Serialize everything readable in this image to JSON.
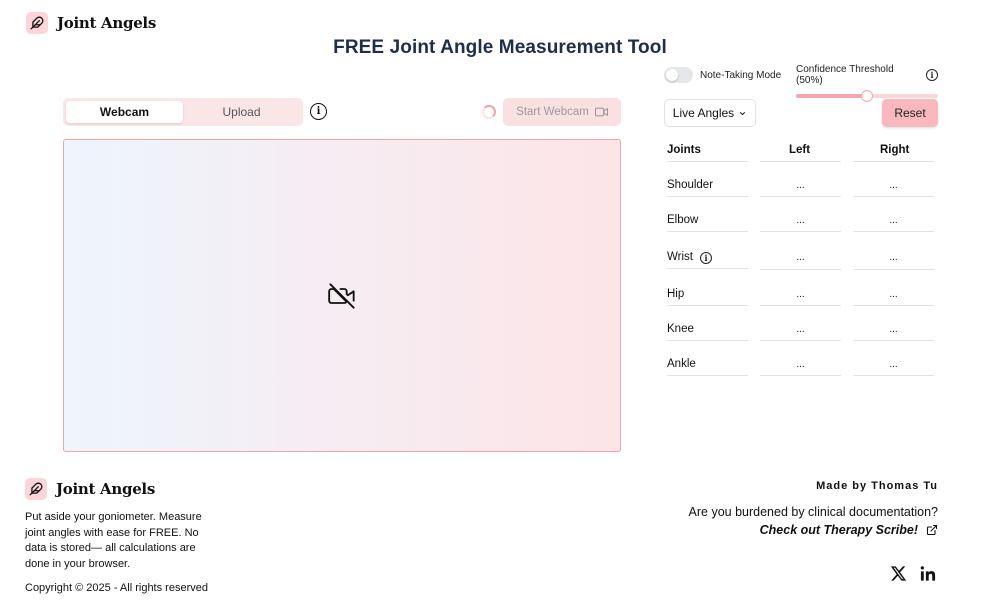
{
  "header": {
    "brand": "Joint Angels"
  },
  "page_title": "FREE Joint Angle Measurement Tool",
  "controls": {
    "note_taking_label": "Note-Taking Mode",
    "note_taking_on": false,
    "confidence_label": "Confidence Threshold (50%)",
    "confidence_value": 0.5
  },
  "tabs": [
    {
      "label": "Webcam",
      "active": true
    },
    {
      "label": "Upload",
      "active": false
    }
  ],
  "start_webcam_label": "Start Webcam",
  "view_select_value": "Live Angles",
  "reset_label": "Reset",
  "angles_table": {
    "headers": [
      "Joints",
      "Left",
      "Right"
    ],
    "rows": [
      {
        "joint": "Shoulder",
        "left": "...",
        "right": "..."
      },
      {
        "joint": "Elbow",
        "left": "...",
        "right": "..."
      },
      {
        "joint": "Wrist",
        "left": "...",
        "right": "..."
      },
      {
        "joint": "Hip",
        "left": "...",
        "right": "..."
      },
      {
        "joint": "Knee",
        "left": "...",
        "right": "..."
      },
      {
        "joint": "Ankle",
        "left": "...",
        "right": "..."
      }
    ]
  },
  "footer": {
    "brand": "Joint Angels",
    "description": "Put aside your goniometer. Measure joint angles with ease for FREE. No data is stored— all calculations are done in your browser.",
    "copyright": "Copyright © 2025 - All rights reserved",
    "made_by": "Made by Thomas Tu",
    "burden_text": "Are you burdened by clinical documentation?",
    "therapy_link": "Check out Therapy Scribe!"
  },
  "icons": {
    "logo": "feather-icon",
    "video_placeholder": "video-off-icon",
    "social": [
      "x-icon",
      "linkedin-icon"
    ]
  },
  "colors": {
    "accent": "#f9b8bd",
    "accent_light": "#fbe0e2",
    "border": "#f4a3a9",
    "title": "#1f2d4d"
  }
}
